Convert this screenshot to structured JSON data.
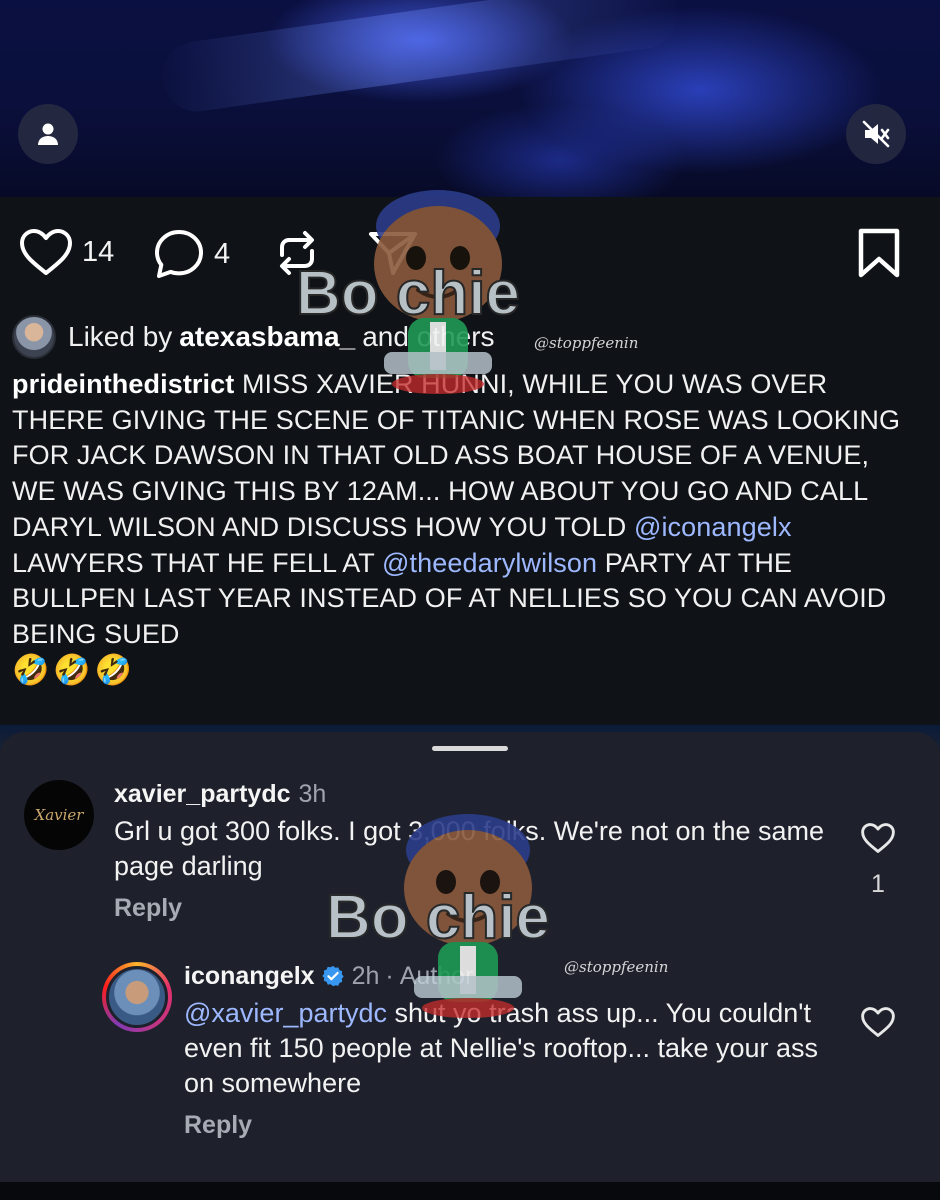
{
  "post": {
    "like_count": "14",
    "comment_count": "4",
    "liked_by_prefix": "Liked by",
    "liked_by_user": "atexasbama_",
    "liked_by_suffix": "and others",
    "caption_user": "prideinthedistrict",
    "caption_part1": "MISS XAVIER HUNNI, WHILE YOU WAS OVER THERE GIVING THE SCENE OF TITANIC WHEN ROSE WAS LOOKING FOR JACK DAWSON IN THAT OLD ASS BOAT HOUSE OF A VENUE, WE WAS GIVING THIS BY 12AM... HOW ABOUT YOU GO AND CALL DARYL WILSON AND DISCUSS HOW YOU TOLD",
    "mention1": "@iconangelx",
    "caption_part2": "LAWYERS THAT HE FELL AT",
    "mention2": "@theedarylwilson",
    "caption_part3": "PARTY AT THE BULLPEN LAST YEAR INSTEAD OF AT NELLIES SO YOU CAN AVOID BEING SUED",
    "caption_emojis": "🤣🤣🤣"
  },
  "comments": [
    {
      "avatar_text": "Xavier",
      "username": "xavier_partydc",
      "time": "3h",
      "text": "Grl u got 300 folks. I got 3,000 folks. We're not on the same page darling",
      "reply_label": "Reply",
      "likes": "1"
    },
    {
      "username": "iconangelx",
      "time": "2h",
      "dot": "·",
      "author_label": "Author",
      "mention": "@xavier_partydc",
      "text": "shut yo trash ass up... You couldn't even fit 150 people at Nellie's rooftop... take your ass on somewhere",
      "reply_label": "Reply"
    }
  ],
  "watermark": {
    "brand": "Bo  chie",
    "handle": "@stoppfeenin"
  },
  "icons": {
    "profile": "person-icon",
    "mute": "speaker-muted-icon",
    "like": "heart-outline-icon",
    "comment": "speech-bubble-icon",
    "repost": "repost-arrows-icon",
    "share": "paper-plane-icon",
    "save": "bookmark-icon",
    "verified": "verified-badge-icon"
  },
  "colors": {
    "background": "#0f1217",
    "sheet": "#1e212c",
    "mention": "#9db8ff",
    "verified": "#3897f0",
    "secondary_text": "#9ea3ad"
  }
}
